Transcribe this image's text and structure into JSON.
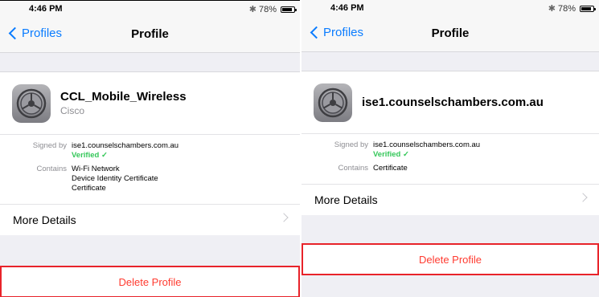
{
  "left": {
    "status": {
      "time": "4:46 PM",
      "battery": "78%"
    },
    "nav": {
      "back": "Profiles",
      "title": "Profile"
    },
    "profile": {
      "name": "CCL_Mobile_Wireless",
      "org": "Cisco"
    },
    "signed_label": "Signed by",
    "signed_value": "ise1.counselschambers.com.au",
    "verified": "Verified ✓",
    "contains_label": "Contains",
    "contains": [
      "Wi-Fi Network",
      "Device Identity Certificate",
      "Certificate"
    ],
    "more_details": "More Details",
    "delete": "Delete Profile"
  },
  "right": {
    "status": {
      "time": "4:46 PM",
      "battery": "78%"
    },
    "nav": {
      "back": "Profiles",
      "title": "Profile"
    },
    "profile": {
      "name": "ise1.counselschambers.com.au"
    },
    "signed_label": "Signed by",
    "signed_value": "ise1.counselschambers.com.au",
    "verified": "Verified ✓",
    "contains_label": "Contains",
    "contains": [
      "Certificate"
    ],
    "more_details": "More Details",
    "delete": "Delete Profile"
  },
  "colors": {
    "link": "#0a7cff",
    "destructive": "#ff3b30",
    "verified": "#34c759",
    "highlight": "#e8232a"
  },
  "icons": {
    "bluetooth": "bluetooth-icon",
    "battery": "battery-icon",
    "back": "chevron-left-icon",
    "disclosure": "chevron-right-icon",
    "profile": "settings-gear-icon"
  }
}
